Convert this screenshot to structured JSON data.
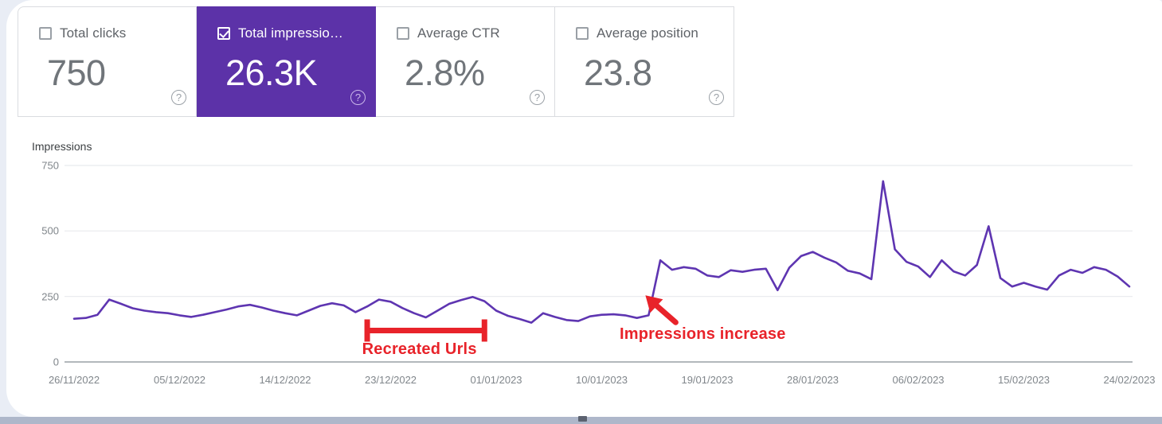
{
  "metric_cards": [
    {
      "label": "Total clicks",
      "value": "750",
      "checked": false,
      "selected": false,
      "help": "?"
    },
    {
      "label": "Total impressio…",
      "value": "26.3K",
      "checked": true,
      "selected": true,
      "help": "?"
    },
    {
      "label": "Average CTR",
      "value": "2.8%",
      "checked": false,
      "selected": false,
      "help": "?"
    },
    {
      "label": "Average position",
      "value": "23.8",
      "checked": false,
      "selected": false,
      "help": "?"
    }
  ],
  "chart_title": "Impressions",
  "annotations": [
    {
      "name": "recreated-urls",
      "text": "Recreated Urls",
      "color": "#e8232a"
    },
    {
      "name": "impressions-increase",
      "text": "Impressions increase",
      "color": "#e8232a"
    }
  ],
  "colors": {
    "selected_card": "#5c32a8",
    "line": "#5e35b1",
    "annotation": "#e8232a",
    "grid": "#e8eaed",
    "axis": "#9aa0a6",
    "page_bg": "#e9edf5"
  },
  "chart_data": {
    "type": "line",
    "title": "Impressions",
    "xlabel": "",
    "ylabel": "Impressions",
    "ylim": [
      0,
      750
    ],
    "yticks": [
      0,
      250,
      500,
      750
    ],
    "grid": true,
    "legend": "none",
    "tick_labels": [
      "26/11/2022",
      "05/12/2022",
      "14/12/2022",
      "23/12/2022",
      "01/01/2023",
      "10/01/2023",
      "19/01/2023",
      "28/01/2023",
      "06/02/2023",
      "15/02/2023",
      "24/02/2023"
    ],
    "tick_indices": [
      0,
      9,
      18,
      27,
      36,
      45,
      54,
      63,
      72,
      81,
      90
    ],
    "series": [
      {
        "name": "Impressions",
        "color": "#5e35b1",
        "values": [
          165,
          168,
          180,
          238,
          222,
          205,
          196,
          190,
          186,
          178,
          172,
          180,
          190,
          200,
          212,
          218,
          208,
          196,
          186,
          178,
          196,
          214,
          224,
          216,
          190,
          212,
          238,
          230,
          206,
          186,
          170,
          196,
          222,
          236,
          248,
          232,
          196,
          176,
          164,
          150,
          186,
          172,
          160,
          156,
          174,
          180,
          182,
          178,
          168,
          178,
          388,
          352,
          362,
          356,
          330,
          324,
          350,
          344,
          352,
          356,
          274,
          360,
          404,
          420,
          398,
          380,
          348,
          338,
          316,
          690,
          430,
          382,
          364,
          324,
          388,
          346,
          330,
          370,
          518,
          320,
          288,
          302,
          288,
          276,
          330,
          352,
          340,
          362,
          352,
          326,
          288
        ]
      }
    ],
    "annotation_markers": [
      {
        "type": "span-bracket",
        "label": "Recreated Urls",
        "start_date": "21/12/2022",
        "end_date": "31/12/2022",
        "start_index": 25,
        "end_index": 35,
        "value_level": 120
      },
      {
        "type": "arrow",
        "label": "Impressions increase",
        "points_at_date": "09/01/2023",
        "points_at_index": 49,
        "points_at_value": 230
      }
    ]
  }
}
